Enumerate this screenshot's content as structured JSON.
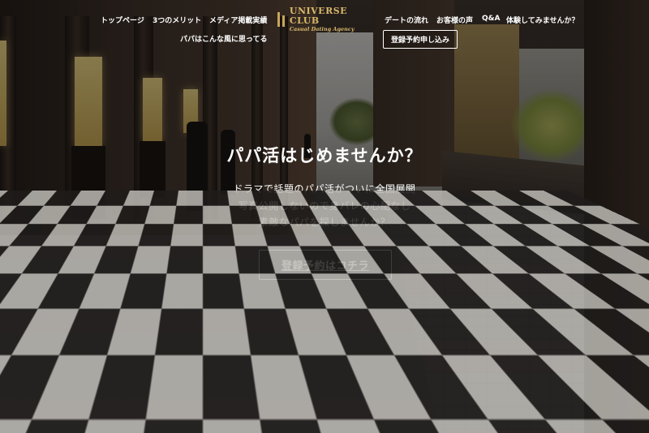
{
  "nav": {
    "left_items": [
      {
        "label": "トップページ"
      },
      {
        "label": "3つのメリット"
      },
      {
        "label": "メディア掲載実績"
      },
      {
        "label": "パパはこんな風に思ってる"
      }
    ],
    "right_items": [
      {
        "label": "デートの流れ"
      },
      {
        "label": "お客様の声"
      },
      {
        "label": "Q&A"
      },
      {
        "label": "体験してみませんか？"
      }
    ],
    "logo": {
      "title": "UNIVERSE CLUB",
      "subtitle": "Casual Dating Agency"
    },
    "reserve_button": "登録予約申し込み"
  },
  "hero": {
    "headline": "パパ活はじめませんか？",
    "lines": [
      "ドラマで話題のパパ活がついに全国展開",
      "写真公開しないので身バレの心配なし",
      "素敵なパパを探しませんか？"
    ],
    "cta_label": "登録予約はコチラ"
  },
  "colors": {
    "logo_gold": "#d8b86c",
    "text": "#ffffff"
  }
}
